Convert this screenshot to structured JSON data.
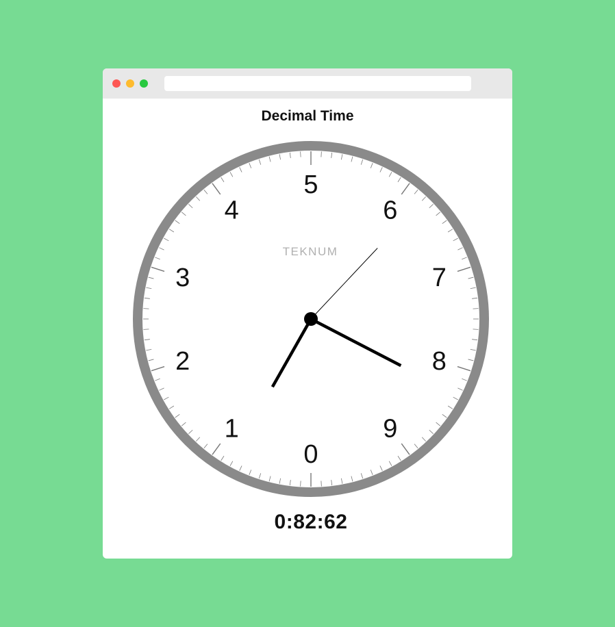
{
  "window": {
    "url_bar_value": ""
  },
  "page": {
    "title": "Decimal Time",
    "digital_time": "0:82:62"
  },
  "clock": {
    "brand": "TEKNUM",
    "numerals": [
      "0",
      "1",
      "2",
      "3",
      "4",
      "5",
      "6",
      "7",
      "8",
      "9"
    ],
    "time": {
      "hours": 0,
      "minutes": 82,
      "seconds": 62
    },
    "colors": {
      "rim": "#8a8a8a",
      "hands": "#000000",
      "ticks": "#777777",
      "brand": "#b0b0b0"
    }
  }
}
